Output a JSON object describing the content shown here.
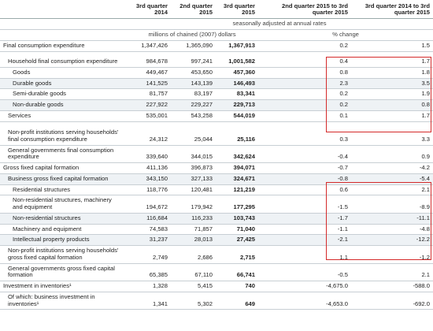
{
  "headers": [
    "",
    "3rd quarter 2014",
    "2nd quarter 2015",
    "3rd quarter 2015",
    "2nd quarter 2015 to 3rd quarter 2015",
    "3rd quarter 2014 to 3rd quarter 2015"
  ],
  "subheader": "seasonally adjusted at annual rates",
  "units_left": "millions of chained (2007) dollars",
  "units_right": "% change",
  "rows": [
    {
      "label": "Final consumption expenditure",
      "v1": "1,347,426",
      "v2": "1,365,090",
      "v3": "1,367,913",
      "p1": "0.2",
      "p2": "1.5"
    },
    {
      "label": "Household final consumption expenditure",
      "v1": "984,678",
      "v2": "997,241",
      "v3": "1,001,582",
      "p1": "0.4",
      "p2": "1.7"
    },
    {
      "label": "Goods",
      "v1": "449,467",
      "v2": "453,650",
      "v3": "457,360",
      "p1": "0.8",
      "p2": "1.8"
    },
    {
      "label": "Durable goods",
      "v1": "141,525",
      "v2": "143,139",
      "v3": "146,493",
      "p1": "2.3",
      "p2": "3.5"
    },
    {
      "label": "Semi-durable goods",
      "v1": "81,757",
      "v2": "83,197",
      "v3": "83,341",
      "p1": "0.2",
      "p2": "1.9"
    },
    {
      "label": "Non-durable goods",
      "v1": "227,922",
      "v2": "229,227",
      "v3": "229,713",
      "p1": "0.2",
      "p2": "0.8"
    },
    {
      "label": "Services",
      "v1": "535,001",
      "v2": "543,258",
      "v3": "544,019",
      "p1": "0.1",
      "p2": "1.7"
    },
    {
      "label": "Non-profit institutions serving households' final consumption expenditure",
      "v1": "24,312",
      "v2": "25,044",
      "v3": "25,116",
      "p1": "0.3",
      "p2": "3.3"
    },
    {
      "label": "General governments final consumption expenditure",
      "v1": "339,640",
      "v2": "344,015",
      "v3": "342,624",
      "p1": "-0.4",
      "p2": "0.9"
    },
    {
      "label": "Gross fixed capital formation",
      "v1": "411,136",
      "v2": "396,873",
      "v3": "394,071",
      "p1": "-0.7",
      "p2": "-4.2"
    },
    {
      "label": "Business gross fixed capital formation",
      "v1": "343,150",
      "v2": "327,133",
      "v3": "324,671",
      "p1": "-0.8",
      "p2": "-5.4"
    },
    {
      "label": "Residential structures",
      "v1": "118,776",
      "v2": "120,481",
      "v3": "121,219",
      "p1": "0.6",
      "p2": "2.1"
    },
    {
      "label": "Non-residential structures, machinery and equipment",
      "v1": "194,672",
      "v2": "179,942",
      "v3": "177,295",
      "p1": "-1.5",
      "p2": "-8.9"
    },
    {
      "label": "Non-residential structures",
      "v1": "116,684",
      "v2": "116,233",
      "v3": "103,743",
      "p1": "-1.7",
      "p2": "-11.1"
    },
    {
      "label": "Machinery and equipment",
      "v1": "74,583",
      "v2": "71,857",
      "v3": "71,040",
      "p1": "-1.1",
      "p2": "-4.8"
    },
    {
      "label": "Intellectual property products",
      "v1": "31,237",
      "v2": "28,013",
      "v3": "27,425",
      "p1": "-2.1",
      "p2": "-12.2"
    },
    {
      "label": "Non-profit institutions serving households' gross fixed capital formation",
      "v1": "2,749",
      "v2": "2,686",
      "v3": "2,715",
      "p1": "1.1",
      "p2": "-1.2"
    },
    {
      "label": "General governments gross fixed capital formation",
      "v1": "65,385",
      "v2": "67,110",
      "v3": "66,741",
      "p1": "-0.5",
      "p2": "2.1"
    },
    {
      "label": "Investment in inventories¹",
      "v1": "1,328",
      "v2": "5,415",
      "v3": "740",
      "p1": "-4,675.0",
      "p2": "-588.0"
    },
    {
      "label": "Of which: business investment in inventories¹",
      "v1": "1,341",
      "v2": "5,302",
      "v3": "649",
      "p1": "-4,653.0",
      "p2": "-692.0"
    }
  ]
}
